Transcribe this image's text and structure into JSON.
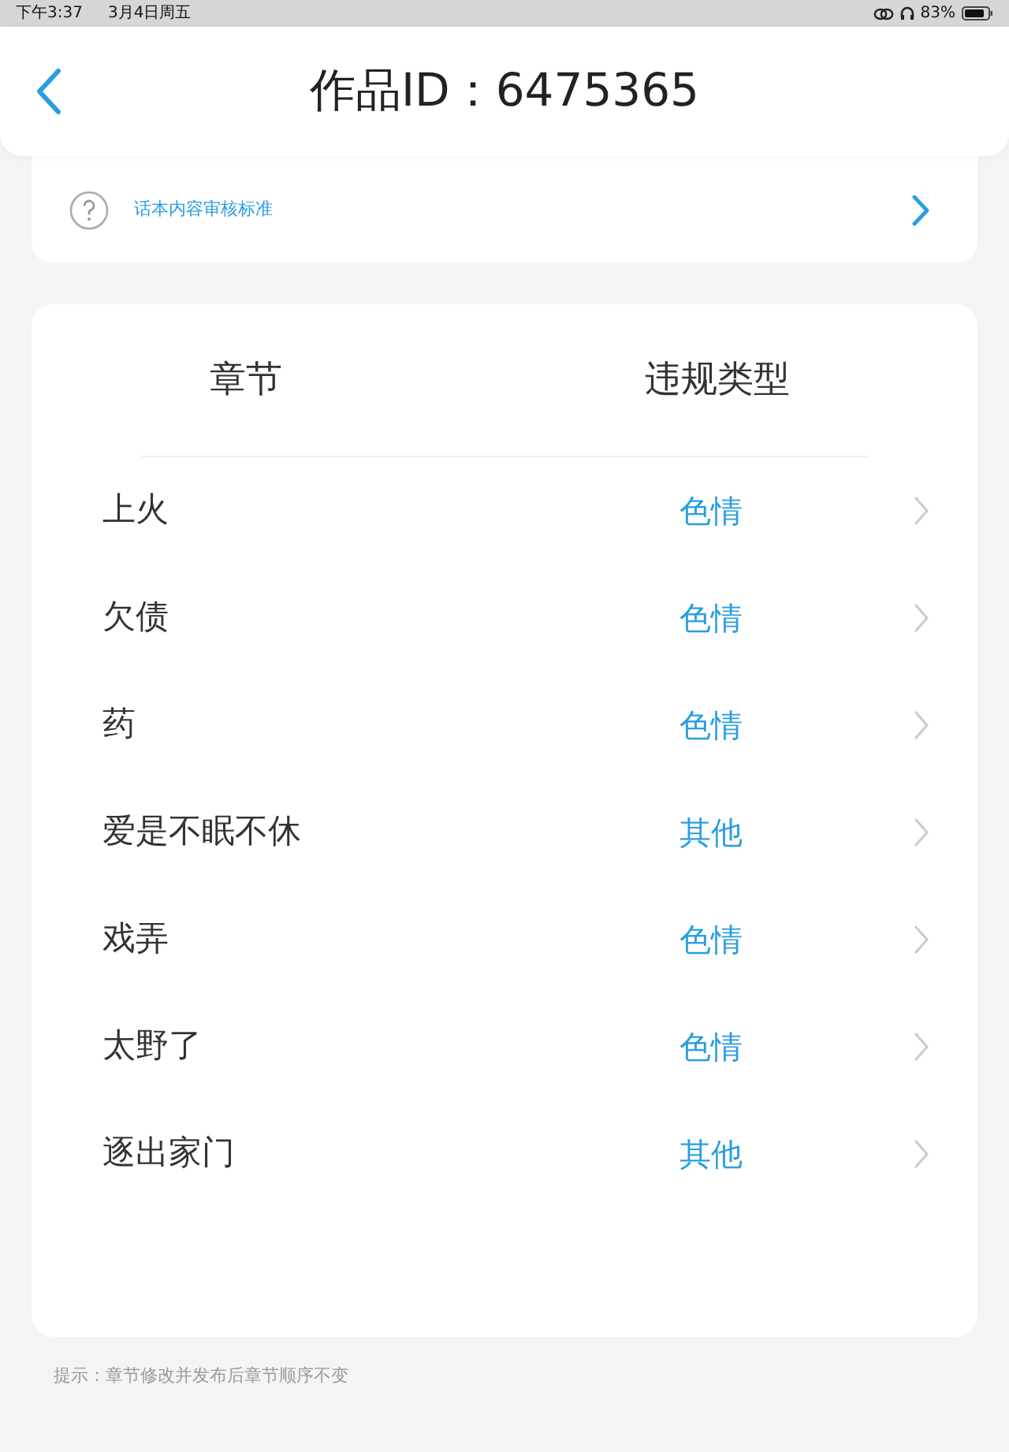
{
  "status_bar": {
    "time": "下午3:37",
    "date": "3月4日周五",
    "battery": "83%"
  },
  "header": {
    "title": "作品ID：6475365"
  },
  "standard_link": {
    "label": "话本内容审核标准"
  },
  "table": {
    "columns": [
      "章节",
      "违规类型"
    ],
    "rows": [
      {
        "chapter": "上火",
        "violation": "色情"
      },
      {
        "chapter": "欠债",
        "violation": "色情"
      },
      {
        "chapter": "药",
        "violation": "色情"
      },
      {
        "chapter": "爱是不眠不休",
        "violation": "其他"
      },
      {
        "chapter": "戏弄",
        "violation": "色情"
      },
      {
        "chapter": "太野了",
        "violation": "色情"
      },
      {
        "chapter": "逐出家门",
        "violation": "其他"
      }
    ]
  },
  "hint": "提示：章节修改并发布后章节顺序不变"
}
